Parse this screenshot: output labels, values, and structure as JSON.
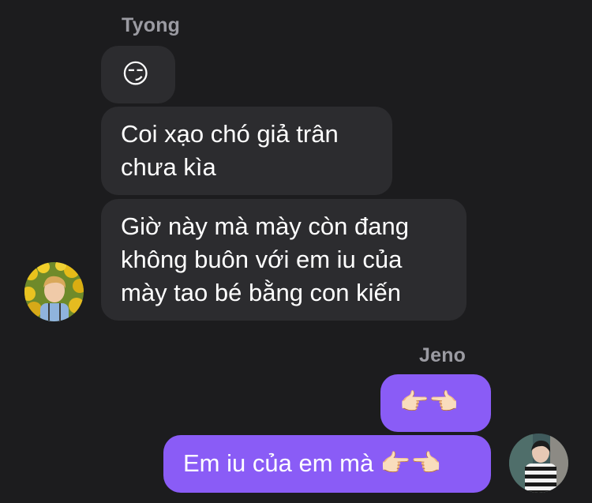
{
  "conversation": {
    "incoming_sender": "Tyong",
    "outgoing_sender": "Jeno",
    "incoming_messages": [
      {
        "text": "😏"
      },
      {
        "text": "Coi xạo chó giả trân\nchưa kìa"
      },
      {
        "text": "Giờ này mà mày còn đang\nkhông buôn với em iu của\nmày tao bé bằng con kiến"
      }
    ],
    "outgoing_messages": [
      {
        "text": "👉🏻👈🏻"
      },
      {
        "text": "Em iu của em mà 👉🏻👈🏻"
      }
    ]
  },
  "colors": {
    "background": "#1c1c1e",
    "incoming_bubble": "#2c2c2f",
    "outgoing_bubble": "#8a5cf6",
    "sender_name": "#9b9ba2"
  },
  "icons": {
    "incoming_avatar": "avatar-photo-sunflowers",
    "outgoing_avatar": "avatar-photo-striped-sweater"
  }
}
